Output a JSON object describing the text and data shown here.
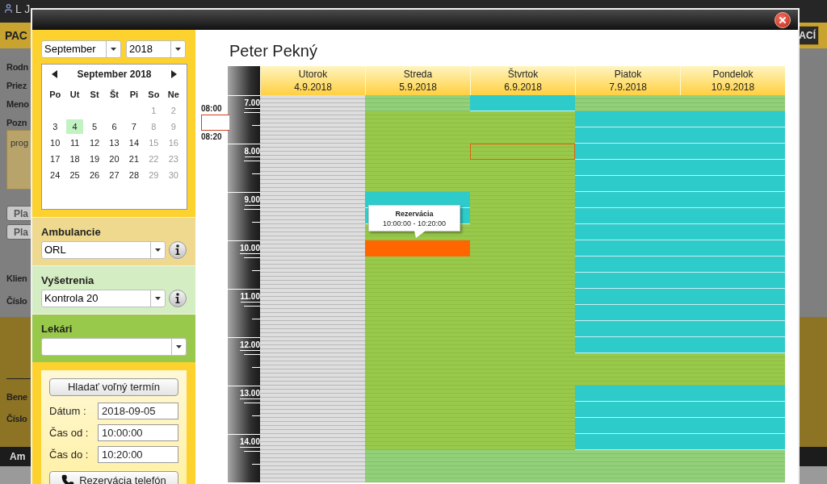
{
  "background": {
    "user": "L J",
    "header_title": "PAC",
    "header_button": "ACÍ",
    "form_labels": [
      "Rodn",
      "Priez",
      "Meno",
      "Pozn"
    ],
    "note_text": "prog",
    "buttons": [
      "Pla",
      "Pla"
    ],
    "client_labels": [
      "Klien",
      "Číslo"
    ],
    "lower_labels": [
      "Bene",
      "Číslo"
    ],
    "bar_label": "Am"
  },
  "sidebar": {
    "month_select": "September",
    "year_select": "2018",
    "calendar": {
      "title": "September 2018",
      "weekdays": [
        "Po",
        "Ut",
        "St",
        "Št",
        "Pi",
        "So",
        "Ne"
      ],
      "weeks": [
        [
          {
            "kind": "blank"
          },
          {
            "kind": "blank"
          },
          {
            "kind": "blank"
          },
          {
            "kind": "blank"
          },
          {
            "kind": "blank"
          },
          {
            "kind": "day",
            "text": "1",
            "muted": true,
            "selected": false
          },
          {
            "kind": "day",
            "text": "2",
            "muted": true,
            "selected": false
          }
        ],
        [
          {
            "kind": "day",
            "text": "3",
            "muted": false,
            "selected": false
          },
          {
            "kind": "day",
            "text": "4",
            "muted": false,
            "selected": true
          },
          {
            "kind": "day",
            "text": "5",
            "muted": false,
            "selected": false
          },
          {
            "kind": "day",
            "text": "6",
            "muted": false,
            "selected": false
          },
          {
            "kind": "day",
            "text": "7",
            "muted": false,
            "selected": false
          },
          {
            "kind": "day",
            "text": "8",
            "muted": true,
            "selected": false
          },
          {
            "kind": "day",
            "text": "9",
            "muted": true,
            "selected": false
          }
        ],
        [
          {
            "kind": "day",
            "text": "10",
            "muted": false,
            "selected": false
          },
          {
            "kind": "day",
            "text": "11",
            "muted": false,
            "selected": false
          },
          {
            "kind": "day",
            "text": "12",
            "muted": false,
            "selected": false
          },
          {
            "kind": "day",
            "text": "13",
            "muted": false,
            "selected": false
          },
          {
            "kind": "day",
            "text": "14",
            "muted": false,
            "selected": false
          },
          {
            "kind": "day",
            "text": "15",
            "muted": true,
            "selected": false
          },
          {
            "kind": "day",
            "text": "16",
            "muted": true,
            "selected": false
          }
        ],
        [
          {
            "kind": "day",
            "text": "17",
            "muted": false,
            "selected": false
          },
          {
            "kind": "day",
            "text": "18",
            "muted": false,
            "selected": false
          },
          {
            "kind": "day",
            "text": "19",
            "muted": false,
            "selected": false
          },
          {
            "kind": "day",
            "text": "20",
            "muted": false,
            "selected": false
          },
          {
            "kind": "day",
            "text": "21",
            "muted": false,
            "selected": false
          },
          {
            "kind": "day",
            "text": "22",
            "muted": true,
            "selected": false
          },
          {
            "kind": "day",
            "text": "23",
            "muted": true,
            "selected": false
          }
        ],
        [
          {
            "kind": "day",
            "text": "24",
            "muted": false,
            "selected": false
          },
          {
            "kind": "day",
            "text": "25",
            "muted": false,
            "selected": false
          },
          {
            "kind": "day",
            "text": "26",
            "muted": false,
            "selected": false
          },
          {
            "kind": "day",
            "text": "27",
            "muted": false,
            "selected": false
          },
          {
            "kind": "day",
            "text": "28",
            "muted": false,
            "selected": false
          },
          {
            "kind": "day",
            "text": "29",
            "muted": true,
            "selected": false
          },
          {
            "kind": "day",
            "text": "30",
            "muted": true,
            "selected": false
          }
        ]
      ]
    },
    "filters": [
      {
        "label": "Ambulancie",
        "value": "ORL",
        "info": true,
        "kind": "ambulance"
      },
      {
        "label": "Vyšetrenia",
        "value": "Kontrola 20",
        "info": true,
        "kind": "exam"
      },
      {
        "label": "Lekári",
        "info": false,
        "kind": "doctor"
      }
    ],
    "search": {
      "button": "Hladať voľný termín",
      "fields": [
        {
          "label": "Dátum :",
          "value": "2018-09-05"
        },
        {
          "label": "Čas od :",
          "value": "10:00:00"
        },
        {
          "label": "Čas do :",
          "value": "10:20:00"
        }
      ],
      "phone_button": "Rezervácia telefón"
    }
  },
  "schedule": {
    "title": "Peter Pekný",
    "hours": [
      "7.00",
      "8.00",
      "9.00",
      "10.00",
      "11.00",
      "12.00",
      "13.00",
      "14.00"
    ],
    "marker": {
      "start": "08:00",
      "end": "08:20"
    },
    "tooltip": {
      "title": "Rezervácia",
      "time": "10:00:00 - 10:20:00"
    },
    "days": [
      {
        "name": "Utorok",
        "date": "4.9.2018",
        "slots": [
          {
            "kind": "gray"
          },
          {
            "kind": "gray"
          },
          {
            "kind": "gray"
          },
          {
            "kind": "gray"
          },
          {
            "kind": "gray"
          },
          {
            "kind": "gray"
          },
          {
            "kind": "gray"
          },
          {
            "kind": "gray"
          },
          {
            "kind": "gray"
          },
          {
            "kind": "gray"
          },
          {
            "kind": "gray"
          },
          {
            "kind": "gray"
          },
          {
            "kind": "gray"
          },
          {
            "kind": "gray"
          },
          {
            "kind": "gray"
          },
          {
            "kind": "gray"
          },
          {
            "kind": "gray"
          },
          {
            "kind": "gray"
          },
          {
            "kind": "gray"
          },
          {
            "kind": "gray"
          },
          {
            "kind": "gray"
          },
          {
            "kind": "gray"
          },
          {
            "kind": "gray"
          },
          {
            "kind": "gray"
          }
        ]
      },
      {
        "name": "Streda",
        "date": "5.9.2018",
        "slots": [
          {
            "kind": "light"
          },
          {
            "kind": "free"
          },
          {
            "kind": "free"
          },
          {
            "kind": "free"
          },
          {
            "kind": "free"
          },
          {
            "kind": "free"
          },
          {
            "kind": "busy"
          },
          {
            "kind": "busy"
          },
          {
            "kind": "free"
          },
          {
            "kind": "reserved"
          },
          {
            "kind": "free"
          },
          {
            "kind": "free"
          },
          {
            "kind": "free"
          },
          {
            "kind": "free"
          },
          {
            "kind": "free"
          },
          {
            "kind": "free"
          },
          {
            "kind": "free"
          },
          {
            "kind": "free"
          },
          {
            "kind": "free"
          },
          {
            "kind": "free"
          },
          {
            "kind": "free"
          },
          {
            "kind": "free"
          },
          {
            "kind": "light"
          },
          {
            "kind": "light"
          }
        ]
      },
      {
        "name": "Štvrtok",
        "date": "6.9.2018",
        "slots": [
          {
            "kind": "busy"
          },
          {
            "kind": "free"
          },
          {
            "kind": "free"
          },
          {
            "kind": "free-outlined"
          },
          {
            "kind": "free"
          },
          {
            "kind": "free"
          },
          {
            "kind": "free"
          },
          {
            "kind": "free"
          },
          {
            "kind": "free"
          },
          {
            "kind": "free"
          },
          {
            "kind": "free"
          },
          {
            "kind": "free"
          },
          {
            "kind": "free"
          },
          {
            "kind": "free"
          },
          {
            "kind": "free"
          },
          {
            "kind": "free"
          },
          {
            "kind": "free"
          },
          {
            "kind": "free"
          },
          {
            "kind": "free"
          },
          {
            "kind": "free"
          },
          {
            "kind": "free"
          },
          {
            "kind": "free"
          },
          {
            "kind": "light"
          },
          {
            "kind": "light"
          }
        ]
      },
      {
        "name": "Piatok",
        "date": "7.9.2018",
        "slots": [
          {
            "kind": "light"
          },
          {
            "kind": "busy"
          },
          {
            "kind": "busy"
          },
          {
            "kind": "busy"
          },
          {
            "kind": "busy"
          },
          {
            "kind": "busy"
          },
          {
            "kind": "busy"
          },
          {
            "kind": "busy"
          },
          {
            "kind": "busy"
          },
          {
            "kind": "busy"
          },
          {
            "kind": "busy"
          },
          {
            "kind": "busy"
          },
          {
            "kind": "busy"
          },
          {
            "kind": "busy"
          },
          {
            "kind": "busy"
          },
          {
            "kind": "busy"
          },
          {
            "kind": "free"
          },
          {
            "kind": "free"
          },
          {
            "kind": "busy"
          },
          {
            "kind": "busy"
          },
          {
            "kind": "busy"
          },
          {
            "kind": "busy"
          },
          {
            "kind": "light"
          },
          {
            "kind": "light"
          }
        ]
      },
      {
        "name": "Pondelok",
        "date": "10.9.2018",
        "slots": [
          {
            "kind": "light"
          },
          {
            "kind": "busy"
          },
          {
            "kind": "busy"
          },
          {
            "kind": "busy"
          },
          {
            "kind": "busy"
          },
          {
            "kind": "busy"
          },
          {
            "kind": "busy"
          },
          {
            "kind": "busy"
          },
          {
            "kind": "busy"
          },
          {
            "kind": "busy"
          },
          {
            "kind": "busy"
          },
          {
            "kind": "busy"
          },
          {
            "kind": "busy"
          },
          {
            "kind": "busy"
          },
          {
            "kind": "busy"
          },
          {
            "kind": "busy"
          },
          {
            "kind": "free"
          },
          {
            "kind": "free"
          },
          {
            "kind": "busy"
          },
          {
            "kind": "busy"
          },
          {
            "kind": "busy"
          },
          {
            "kind": "busy"
          },
          {
            "kind": "light"
          },
          {
            "kind": "light"
          }
        ]
      }
    ]
  }
}
